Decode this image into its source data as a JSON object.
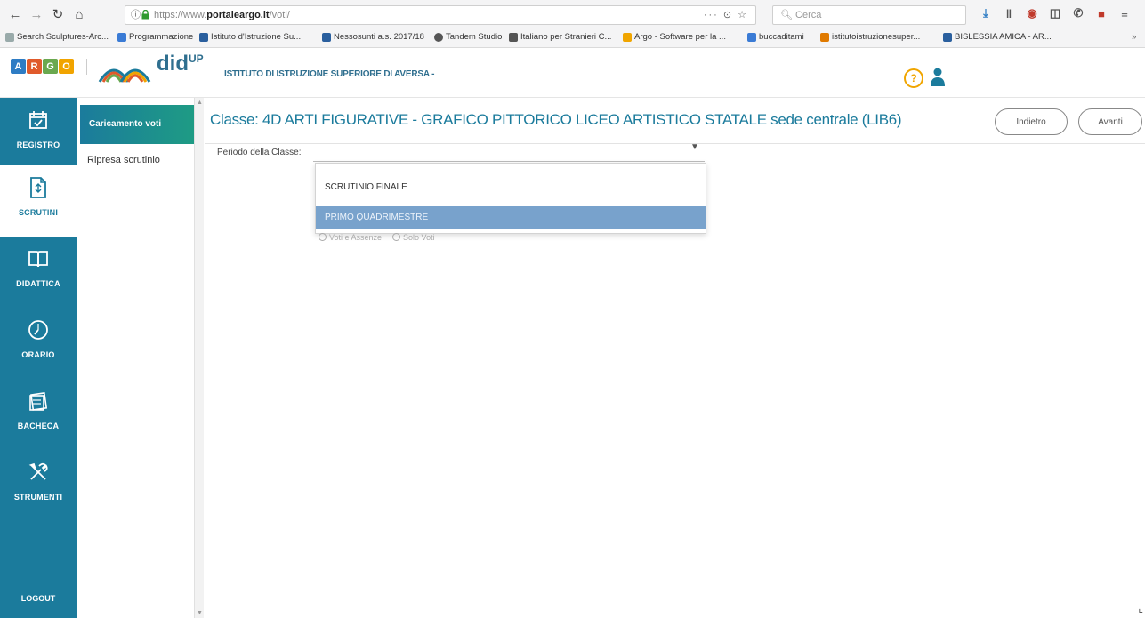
{
  "browser": {
    "url_prefix": "https://www.",
    "url_domain": "portaleargo.it",
    "url_path": "/voti/",
    "url_actions": "··· ⊙ ☆",
    "search_placeholder": "Cerca",
    "bookmarks": [
      {
        "label": "Search Sculptures-Arc...",
        "color": "#9aa"
      },
      {
        "label": "Programmazione",
        "color": "#3a7bd5"
      },
      {
        "label": "Istituto d'Istruzione Su...",
        "color": "#2a5f9e"
      },
      {
        "label": "Nessosunti a.s. 2017/18",
        "color": "#2a5f9e"
      },
      {
        "label": "Tandem Studio",
        "color": "#555"
      },
      {
        "label": "Italiano per Stranieri C...",
        "color": "#555"
      },
      {
        "label": "Argo - Software per la ...",
        "color": "#f0a500"
      },
      {
        "label": "buccaditami",
        "color": "#3a7bd5"
      },
      {
        "label": "istitutoistruzionesuper...",
        "color": "#e07a00"
      },
      {
        "label": "BISLESSIA AMICA - AR...",
        "color": "#2a5f9e"
      }
    ]
  },
  "header": {
    "argo_letters": [
      "A",
      "R",
      "G",
      "O"
    ],
    "argo_colors": [
      "#2e7cc4",
      "#e05a2b",
      "#6aa84f",
      "#f1a400"
    ],
    "app_name": "did",
    "app_sup": "UP",
    "school": "ISTITUTO DI ISTRUZIONE SUPERIORE DI AVERSA -",
    "help_label": "?"
  },
  "left_nav": {
    "items": [
      {
        "label": "REGISTRO",
        "icon": "calendar-check-icon"
      },
      {
        "label": "SCRUTINI",
        "icon": "document-icon"
      },
      {
        "label": "DIDATTICA",
        "icon": "book-icon"
      },
      {
        "label": "ORARIO",
        "icon": "clock-icon"
      },
      {
        "label": "BACHECA",
        "icon": "board-icon"
      },
      {
        "label": "STRUMENTI",
        "icon": "tools-icon"
      }
    ],
    "active": "SCRUTINI",
    "logout": "LOGOUT"
  },
  "sub_menu": {
    "active_label": "Caricamento voti",
    "items": [
      "Ripresa scrutinio"
    ]
  },
  "main": {
    "title": "Classe: 4D ARTI FIGURATIVE - GRAFICO PITTORICO LICEO ARTISTICO STATALE sede centrale (LIB6)",
    "back_button": "Indietro",
    "next_button": "Avanti",
    "period_label": "Periodo della Classe:",
    "period_options": [
      "SCRUTINIO FINALE",
      "PRIMO QUADRIMESTRE"
    ],
    "selected_option": "PRIMO QUADRIMESTRE",
    "radio_options": [
      "Voti e Assenze",
      "Solo Voti"
    ]
  }
}
